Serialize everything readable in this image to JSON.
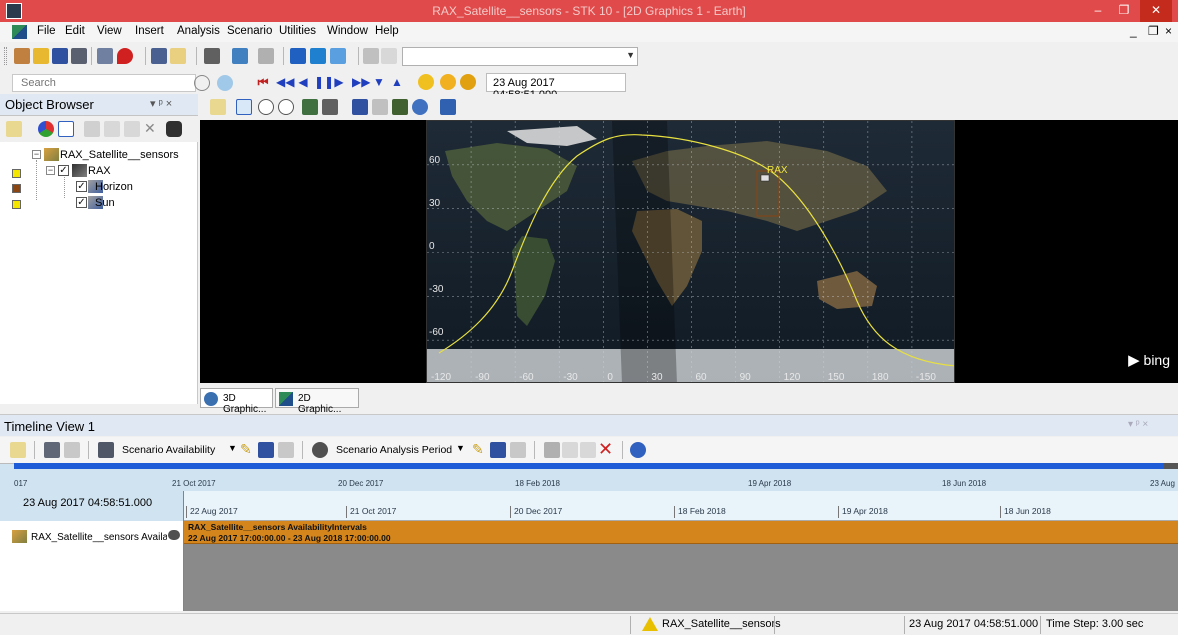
{
  "window": {
    "title": "RAX_Satellite__sensors - STK 10 - [2D Graphics 1 - Earth]",
    "minimize": "–",
    "restore": "❐",
    "close": "✕",
    "mdi_min": "_",
    "mdi_restore": "❐",
    "mdi_close": "×"
  },
  "menu": [
    "File",
    "Edit",
    "View",
    "Insert",
    "Analysis",
    "Scenario",
    "Utilities",
    "Window",
    "Help"
  ],
  "search": {
    "placeholder": "Search"
  },
  "animation": {
    "current_time": "23 Aug 2017 04:58:51.000"
  },
  "object_browser": {
    "title": "Object Browser",
    "pin": "▾ ᵖ ×",
    "tree": {
      "scenario": "RAX_Satellite__sensors",
      "satellite": "RAX",
      "sensors": [
        "Horizon",
        "Sun"
      ]
    },
    "colors": {
      "satellite": "#f5e600",
      "horizon": "#8b4513",
      "sun": "#f5e600"
    }
  },
  "map": {
    "lat_labels": [
      "60",
      "30",
      "0",
      "-30",
      "-60"
    ],
    "lon_labels": [
      "-120",
      "-90",
      "-60",
      "-30",
      "0",
      "30",
      "60",
      "90",
      "120",
      "150",
      "180",
      "-150"
    ],
    "satellite_label": "RAX",
    "ground_track_color": "#e8e040",
    "attribution": "bing"
  },
  "doc_tabs": [
    "3D Graphic...",
    "2D Graphic..."
  ],
  "timeline": {
    "title": "Timeline View 1",
    "controls": "▾ ᵖ ×",
    "filter_label": "Scenario Availability",
    "period_label": "Scenario Analysis Period",
    "current_time": "23 Aug 2017 04:58:51.000",
    "overview_ticks": [
      "017",
      "21 Oct 2017",
      "20 Dec 2017",
      "18 Feb 2018",
      "19 Apr 2018",
      "18 Jun 2018",
      "23 Aug"
    ],
    "axis_ticks": [
      "22 Aug 2017",
      "21 Oct 2017",
      "20 Dec 2017",
      "18 Feb 2018",
      "19 Apr 2018",
      "18 Jun 2018"
    ],
    "row_label": "RAX_Satellite__sensors Availabil",
    "bar_title": "RAX_Satellite__sensors AvailabilityIntervals",
    "bar_interval": "22 Aug 2017 17:00:00.00  -  23 Aug 2018 17:00:00.00",
    "bar_color": "#d4861c"
  },
  "status": {
    "scenario": "RAX_Satellite__sensors",
    "time": "23 Aug 2017 04:58:51.000",
    "step": "Time Step: 3.00 sec"
  }
}
